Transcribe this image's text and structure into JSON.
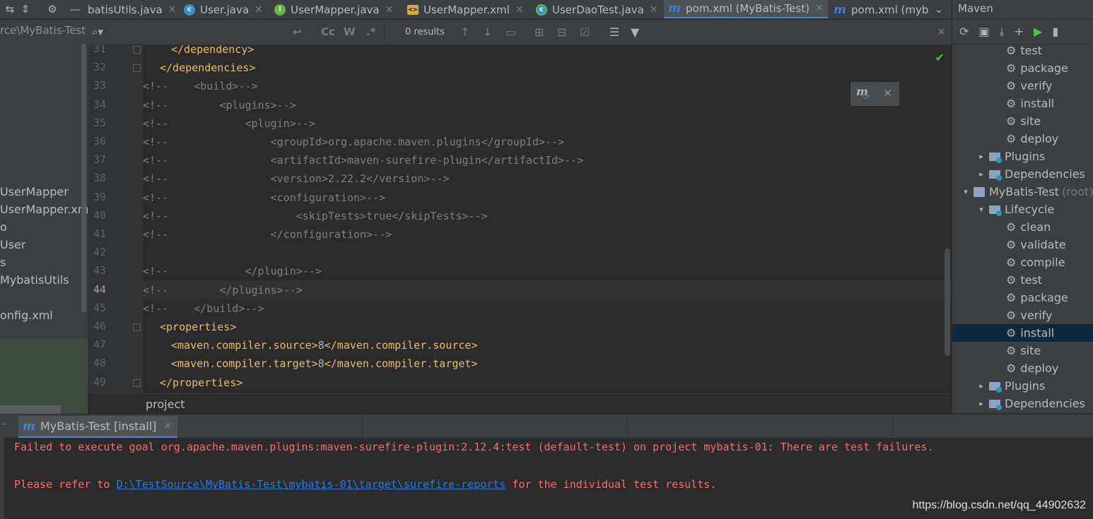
{
  "tabs": [
    {
      "name": "batisUtils.java",
      "kind": "class",
      "active": false
    },
    {
      "name": "User.java",
      "kind": "class",
      "active": false
    },
    {
      "name": "UserMapper.java",
      "kind": "iface",
      "active": false
    },
    {
      "name": "UserMapper.xml",
      "kind": "xml",
      "active": false
    },
    {
      "name": "UserDaoTest.java",
      "kind": "test",
      "active": false
    },
    {
      "name": "pom.xml (MyBatis-Test)",
      "kind": "maven",
      "active": true
    },
    {
      "name": "pom.xml (myb",
      "kind": "maven",
      "active": false
    }
  ],
  "project": {
    "path": "rce\\MyBatis-Test",
    "items": [
      "",
      "UserMapper",
      "UserMapper.xml",
      "o",
      "User",
      "s",
      "MybatisUtils",
      "",
      "onfig.xml"
    ]
  },
  "find": {
    "query": "",
    "results": "0 results",
    "case_label": "Cc",
    "word_label": "W",
    "regex_label": ".*"
  },
  "editor": {
    "current_line": 44,
    "lines": [
      {
        "n": 31,
        "indent": 10,
        "kind": "tag",
        "text": "</dependency>"
      },
      {
        "n": 32,
        "indent": 6,
        "kind": "tag",
        "text": "</dependencies>"
      },
      {
        "n": 33,
        "indent": 0,
        "kind": "cmt",
        "text": "<!--    <build>-->"
      },
      {
        "n": 34,
        "indent": 0,
        "kind": "cmt",
        "text": "<!--        <plugins>-->"
      },
      {
        "n": 35,
        "indent": 0,
        "kind": "cmt",
        "text": "<!--            <plugin>-->"
      },
      {
        "n": 36,
        "indent": 0,
        "kind": "cmt",
        "text": "<!--                <groupId>org.apache.maven.plugins</groupId>-->"
      },
      {
        "n": 37,
        "indent": 0,
        "kind": "cmt",
        "text": "<!--                <artifactId>maven-surefire-plugin</artifactId>-->"
      },
      {
        "n": 38,
        "indent": 0,
        "kind": "cmt",
        "text": "<!--                <version>2.22.2</version>-->"
      },
      {
        "n": 39,
        "indent": 0,
        "kind": "cmt",
        "text": "<!--                <configuration>-->"
      },
      {
        "n": 40,
        "indent": 0,
        "kind": "cmt",
        "text": "<!--                    <skipTests>true</skipTests>-->"
      },
      {
        "n": 41,
        "indent": 0,
        "kind": "cmt",
        "text": "<!--                </configuration>-->"
      },
      {
        "n": 42,
        "indent": 0,
        "kind": "blank",
        "text": ""
      },
      {
        "n": 43,
        "indent": 0,
        "kind": "cmt",
        "text": "<!--            </plugin>-->"
      },
      {
        "n": 44,
        "indent": 0,
        "kind": "cmt",
        "text": "<!--        </plugins>-->"
      },
      {
        "n": 45,
        "indent": 0,
        "kind": "cmt",
        "text": "<!--    </build>-->"
      },
      {
        "n": 46,
        "indent": 6,
        "kind": "tag",
        "text": "<properties>"
      },
      {
        "n": 47,
        "indent": 10,
        "kind": "prop",
        "open": "<maven.compiler.source>",
        "value": "8",
        "close": "</maven.compiler.source>"
      },
      {
        "n": 48,
        "indent": 10,
        "kind": "prop",
        "open": "<maven.compiler.target>",
        "value": "8",
        "close": "</maven.compiler.target>"
      },
      {
        "n": 49,
        "indent": 6,
        "kind": "tag",
        "text": "</properties>"
      }
    ]
  },
  "breadcrumb": "project",
  "maven": {
    "title": "Maven",
    "tree": [
      {
        "label": "test",
        "kind": "goal",
        "level": 2
      },
      {
        "label": "package",
        "kind": "goal",
        "level": 2
      },
      {
        "label": "verify",
        "kind": "goal",
        "level": 2
      },
      {
        "label": "install",
        "kind": "goal",
        "level": 2
      },
      {
        "label": "site",
        "kind": "goal",
        "level": 2
      },
      {
        "label": "deploy",
        "kind": "goal",
        "level": 2
      },
      {
        "label": "Plugins",
        "kind": "folder",
        "level": 1,
        "expanded": false
      },
      {
        "label": "Dependencies",
        "kind": "folder",
        "level": 1,
        "expanded": false
      },
      {
        "label": "MyBatis-Test",
        "kind": "module",
        "level": 0,
        "expanded": true,
        "suffix": "(root)"
      },
      {
        "label": "Lifecycle",
        "kind": "folder",
        "level": 1,
        "expanded": true
      },
      {
        "label": "clean",
        "kind": "goal",
        "level": 2
      },
      {
        "label": "validate",
        "kind": "goal",
        "level": 2
      },
      {
        "label": "compile",
        "kind": "goal",
        "level": 2
      },
      {
        "label": "test",
        "kind": "goal",
        "level": 2
      },
      {
        "label": "package",
        "kind": "goal",
        "level": 2
      },
      {
        "label": "verify",
        "kind": "goal",
        "level": 2
      },
      {
        "label": "install",
        "kind": "goal",
        "level": 2,
        "selected": true
      },
      {
        "label": "site",
        "kind": "goal",
        "level": 2
      },
      {
        "label": "deploy",
        "kind": "goal",
        "level": 2
      },
      {
        "label": "Plugins",
        "kind": "folder",
        "level": 1,
        "expanded": false
      },
      {
        "label": "Dependencies",
        "kind": "folder",
        "level": 1,
        "expanded": false
      }
    ]
  },
  "run": {
    "tab_label": "MyBatis-Test [install]",
    "error_line": "Failed to execute goal org.apache.maven.plugins:maven-surefire-plugin:2.12.4:test (default-test) on project mybatis-01: There are test failures.",
    "refer_prefix": "Please refer to ",
    "refer_link": "D:\\TestSource\\MyBatis-Test\\mybatis-01\\target\\surefire-reports",
    "refer_suffix": " for the individual test results."
  },
  "watermark": "https://blog.csdn.net/qq_44902632",
  "colors": {
    "tag": "#e8bf6a",
    "comment": "#808080",
    "error": "#ff6b68",
    "link": "#287bde",
    "selection": "#0d293e",
    "accent": "#4a88c7"
  }
}
